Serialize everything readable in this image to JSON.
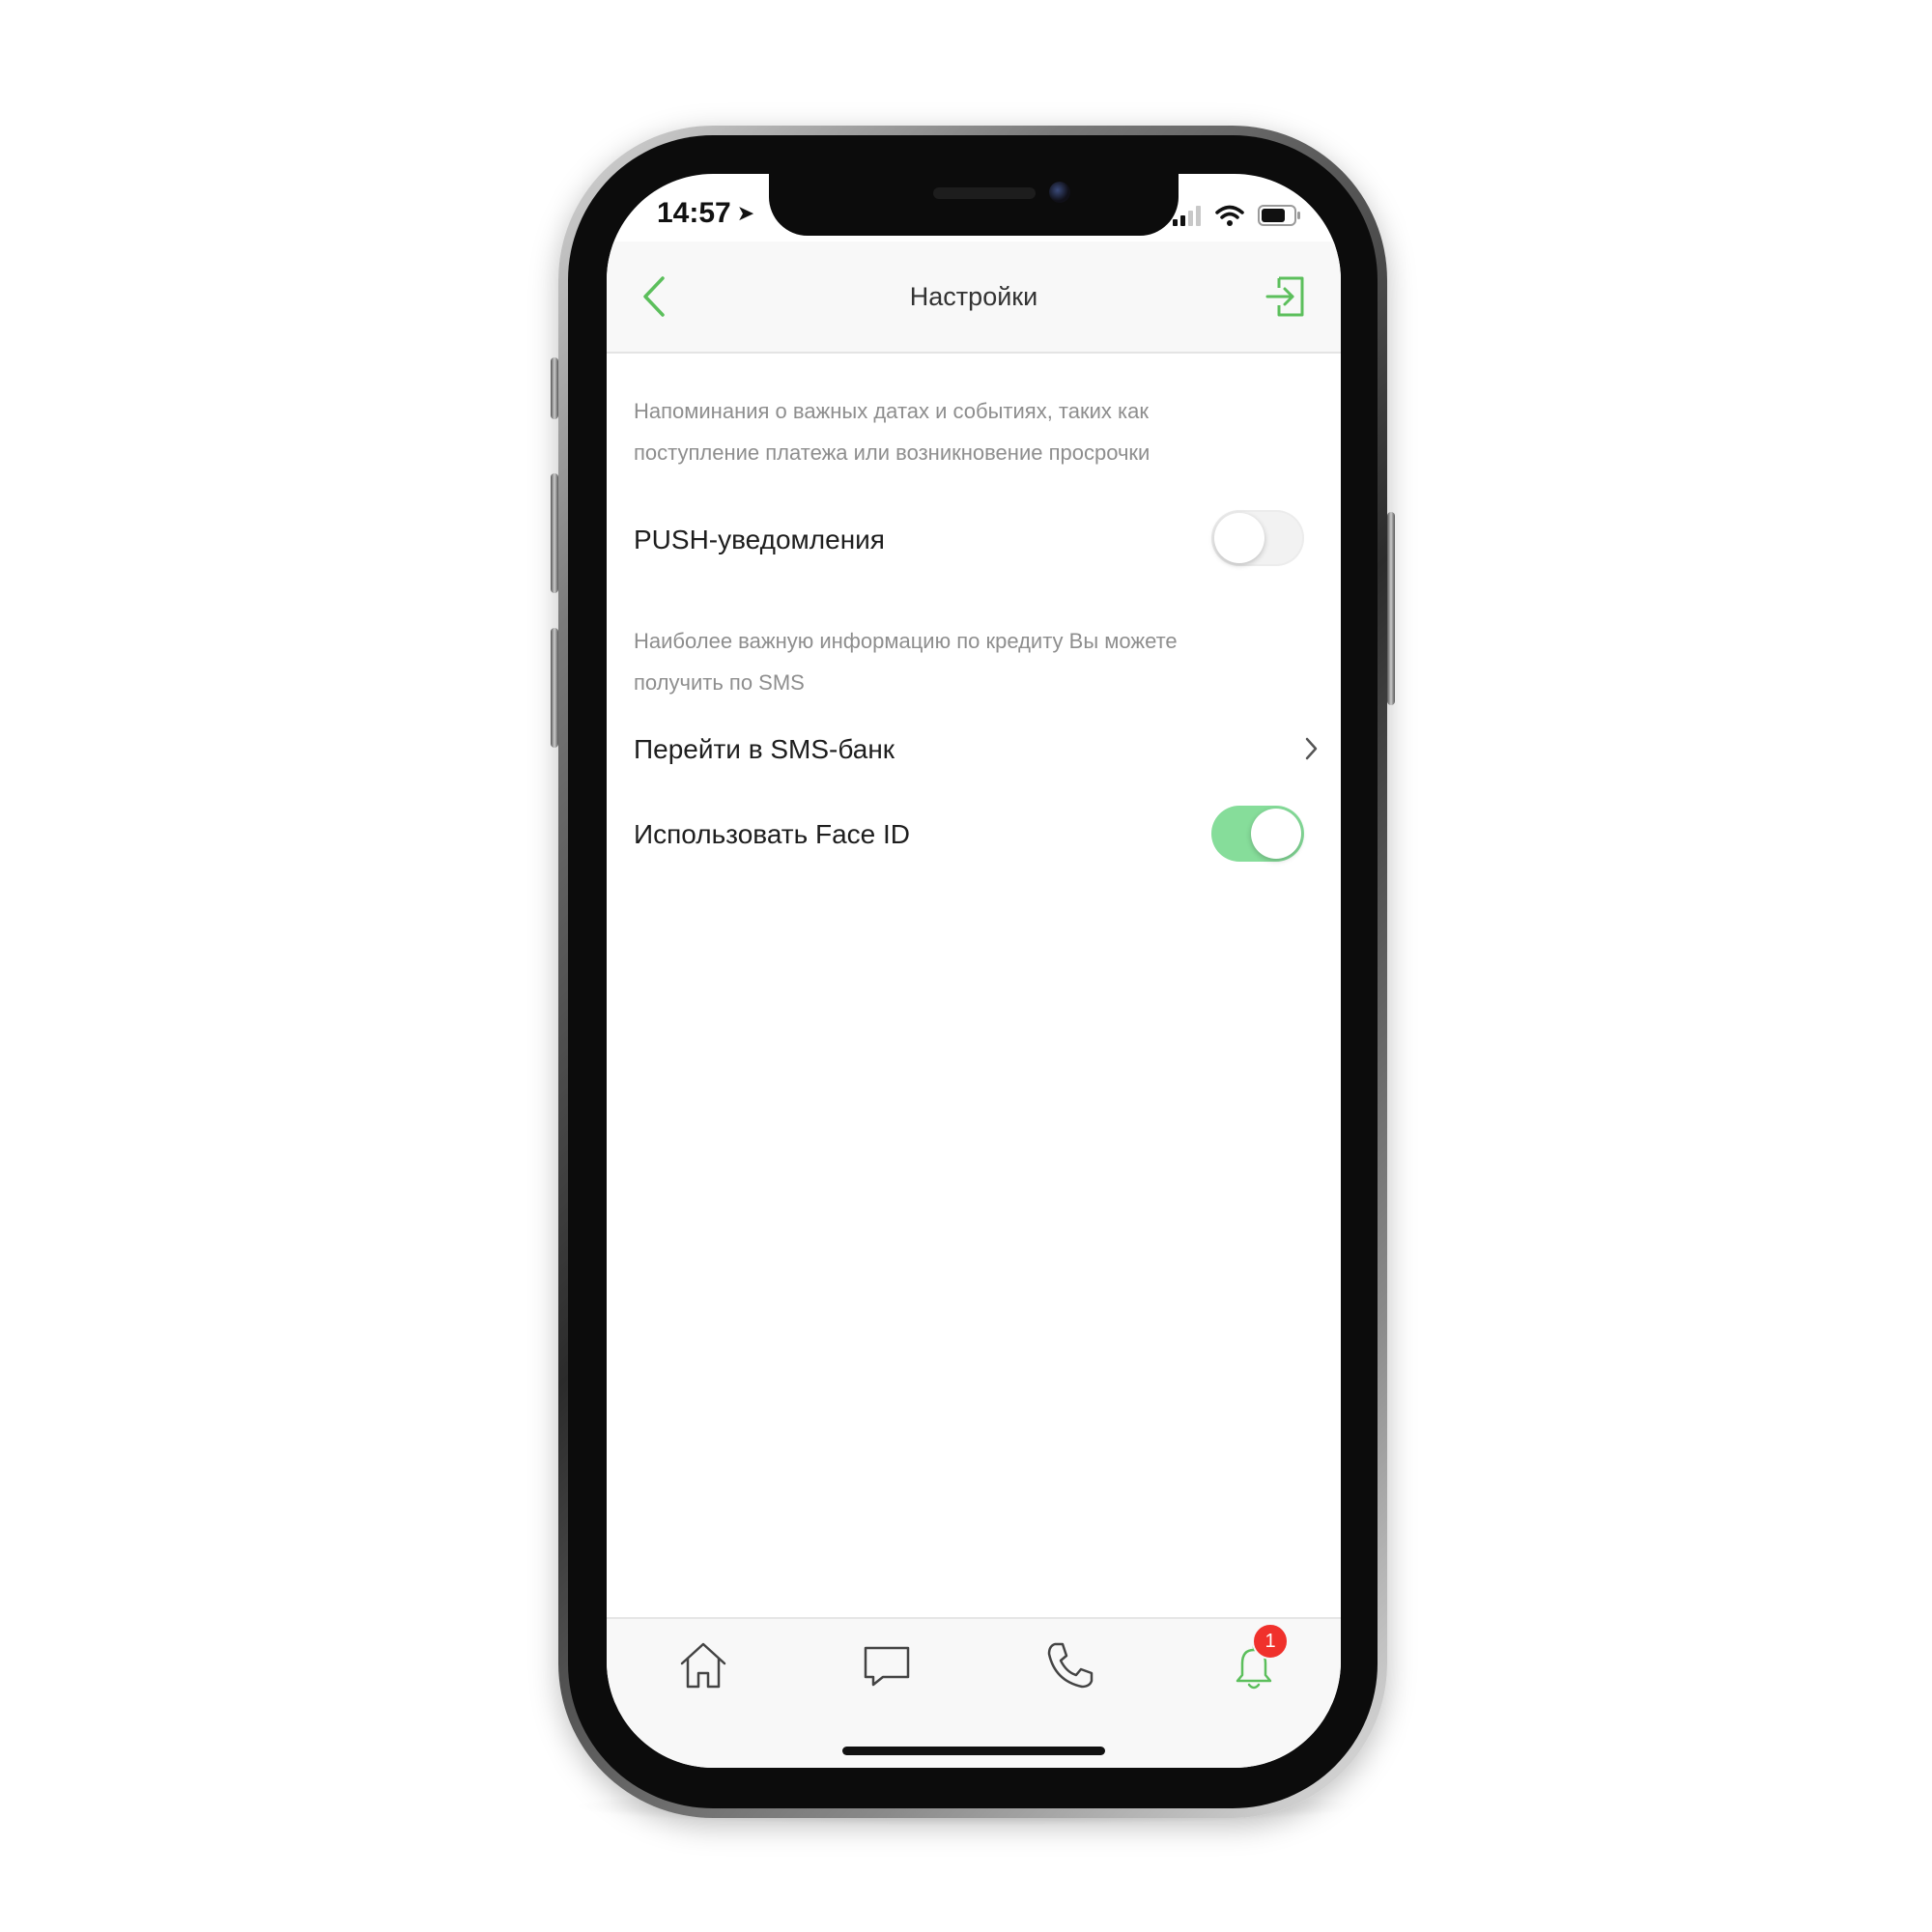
{
  "status_bar": {
    "time": "14:57",
    "icons": [
      "location-arrow-icon",
      "signal-icon",
      "wifi-icon",
      "battery-icon"
    ]
  },
  "header": {
    "title": "Настройки",
    "back_icon": "chevron-left-icon",
    "logout_icon": "logout-icon"
  },
  "settings": {
    "push_description": "Напоминания о важных датах и событиях, таких как поступление платежа или возникновение просрочки",
    "push_label": "PUSH-уведомления",
    "push_enabled": false,
    "sms_description": "Наиболее важную информацию по кредиту Вы можете получить по SMS",
    "sms_label": "Перейти в SMS-банк",
    "faceid_label": "Использовать Face ID",
    "faceid_enabled": true
  },
  "tabbar": {
    "items": [
      {
        "icon": "home-icon"
      },
      {
        "icon": "chat-icon"
      },
      {
        "icon": "phone-icon"
      },
      {
        "icon": "bell-icon",
        "badge": "1"
      }
    ]
  },
  "colors": {
    "accent": "#5cbf5c",
    "toggle_on": "#86dd9a",
    "badge": "#f0312c"
  }
}
